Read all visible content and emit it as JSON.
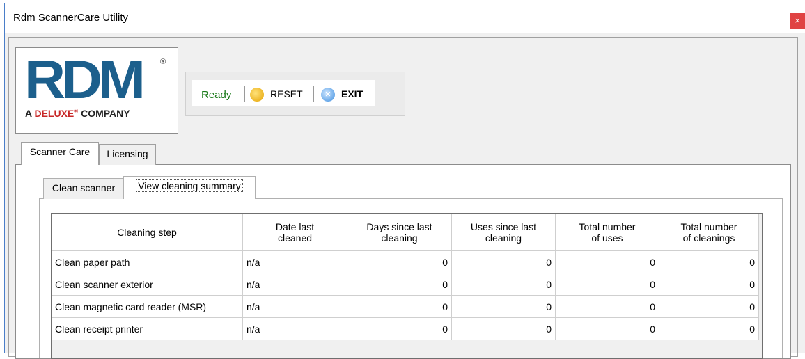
{
  "window": {
    "title": "Rdm ScannerCare Utility",
    "close_glyph": "×"
  },
  "logo": {
    "brand": "RDM",
    "registered": "®",
    "sub_prefix": "A ",
    "sub_accent": "DELUXE",
    "sub_accent_mark": "®",
    "sub_suffix": " COMPANY"
  },
  "toolbar": {
    "status": "Ready",
    "reset_label": "RESET",
    "exit_label": "EXIT",
    "reset_icon": "reset-icon",
    "exit_icon": "exit-icon"
  },
  "outer_tabs": [
    {
      "label": "Scanner Care"
    },
    {
      "label": "Licensing"
    }
  ],
  "inner_tabs": [
    {
      "label": "Clean scanner"
    },
    {
      "label": "View cleaning summary"
    }
  ],
  "table": {
    "columns": [
      {
        "line1": "Cleaning step",
        "line2": ""
      },
      {
        "line1": "Date last",
        "line2": "cleaned"
      },
      {
        "line1": "Days since last",
        "line2": "cleaning"
      },
      {
        "line1": "Uses since last",
        "line2": "cleaning"
      },
      {
        "line1": "Total number",
        "line2": "of uses"
      },
      {
        "line1": "Total number",
        "line2": "of cleanings"
      }
    ],
    "rows": [
      {
        "step": "Clean paper path",
        "date": "n/a",
        "days": "0",
        "uses": "0",
        "total_uses": "0",
        "total_cleanings": "0"
      },
      {
        "step": "Clean scanner exterior",
        "date": "n/a",
        "days": "0",
        "uses": "0",
        "total_uses": "0",
        "total_cleanings": "0"
      },
      {
        "step": "Clean magnetic card reader (MSR)",
        "date": "n/a",
        "days": "0",
        "uses": "0",
        "total_uses": "0",
        "total_cleanings": "0"
      },
      {
        "step": "Clean receipt printer",
        "date": "n/a",
        "days": "0",
        "uses": "0",
        "total_uses": "0",
        "total_cleanings": "0"
      }
    ]
  },
  "colors": {
    "status_green": "#1a7a1a",
    "logo_blue": "#1c5f8c",
    "logo_red": "#c82828",
    "close_red": "#e04343"
  }
}
